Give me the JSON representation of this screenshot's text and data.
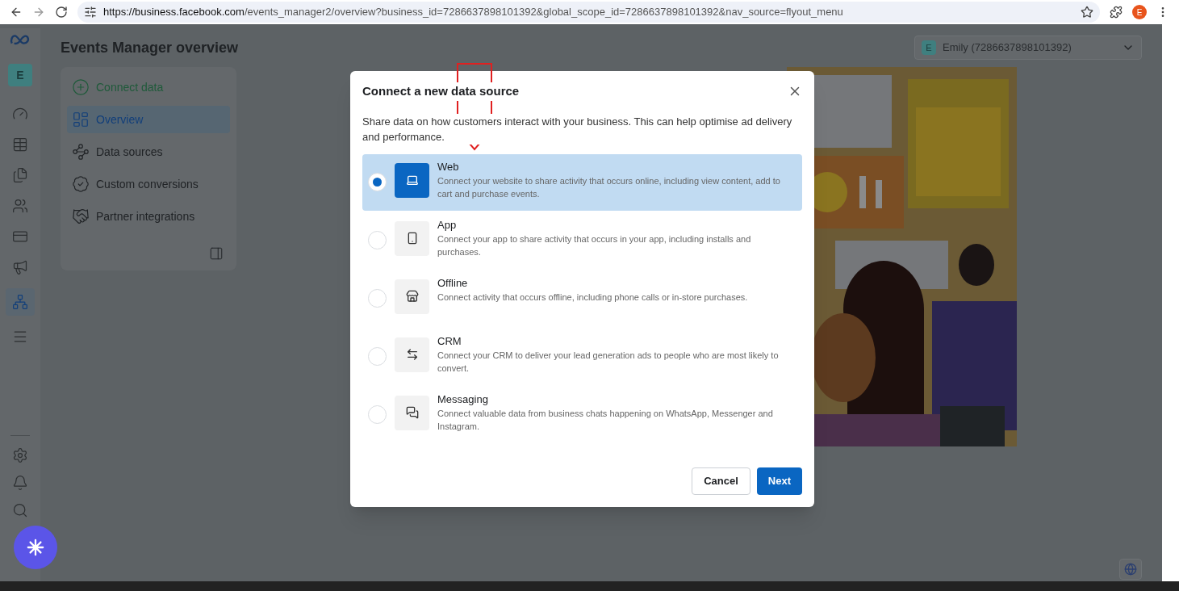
{
  "browser": {
    "url_host": "https://business.facebook.com",
    "url_path": "/events_manager2/overview?business_id=7286637898101392&global_scope_id=7286637898101392&nav_source=flyout_menu",
    "profile_initial": "E"
  },
  "header": {
    "title": "Events Manager overview",
    "account": {
      "initial": "E",
      "name": "Emily (7286637898101392)"
    }
  },
  "rail": {
    "avatar": "E",
    "items": [
      {
        "kind": "gauge",
        "selected": false
      },
      {
        "kind": "table",
        "selected": false
      },
      {
        "kind": "pages",
        "selected": false
      },
      {
        "kind": "people",
        "selected": false
      },
      {
        "kind": "card",
        "selected": false
      },
      {
        "kind": "megaphone",
        "selected": false
      },
      {
        "kind": "network",
        "selected": true
      },
      {
        "kind": "menu",
        "selected": false
      }
    ],
    "bottom_items": [
      {
        "kind": "settings"
      },
      {
        "kind": "bell"
      },
      {
        "kind": "search"
      }
    ]
  },
  "nav": {
    "items": [
      {
        "label": "Connect data",
        "kind": "action",
        "selected": false
      },
      {
        "label": "Overview",
        "kind": "overview",
        "selected": true
      },
      {
        "label": "Data sources",
        "kind": "sources",
        "selected": false
      },
      {
        "label": "Custom conversions",
        "kind": "conversions",
        "selected": false
      },
      {
        "label": "Partner integrations",
        "kind": "partners",
        "selected": false
      }
    ]
  },
  "modal": {
    "title": "Connect a new data source",
    "description": "Share data on how customers interact with your business. This can help optimise ad delivery and performance.",
    "options": [
      {
        "kind": "web",
        "title": "Web",
        "description": "Connect your website to share activity that occurs online, including view content, add to cart and purchase events.",
        "selected": true
      },
      {
        "kind": "app",
        "title": "App",
        "description": "Connect your app to share activity that occurs in your app, including installs and purchases.",
        "selected": false
      },
      {
        "kind": "offline",
        "title": "Offline",
        "description": "Connect activity that occurs offline, including phone calls or in-store purchases.",
        "selected": false
      },
      {
        "kind": "crm",
        "title": "CRM",
        "description": "Connect your CRM to deliver your lead generation ads to people who are most likely to convert.",
        "selected": false
      },
      {
        "kind": "messaging",
        "title": "Messaging",
        "description": "Connect valuable data from business chats happening on WhatsApp, Messenger and Instagram.",
        "selected": false
      }
    ],
    "cancel": "Cancel",
    "next": "Next"
  }
}
